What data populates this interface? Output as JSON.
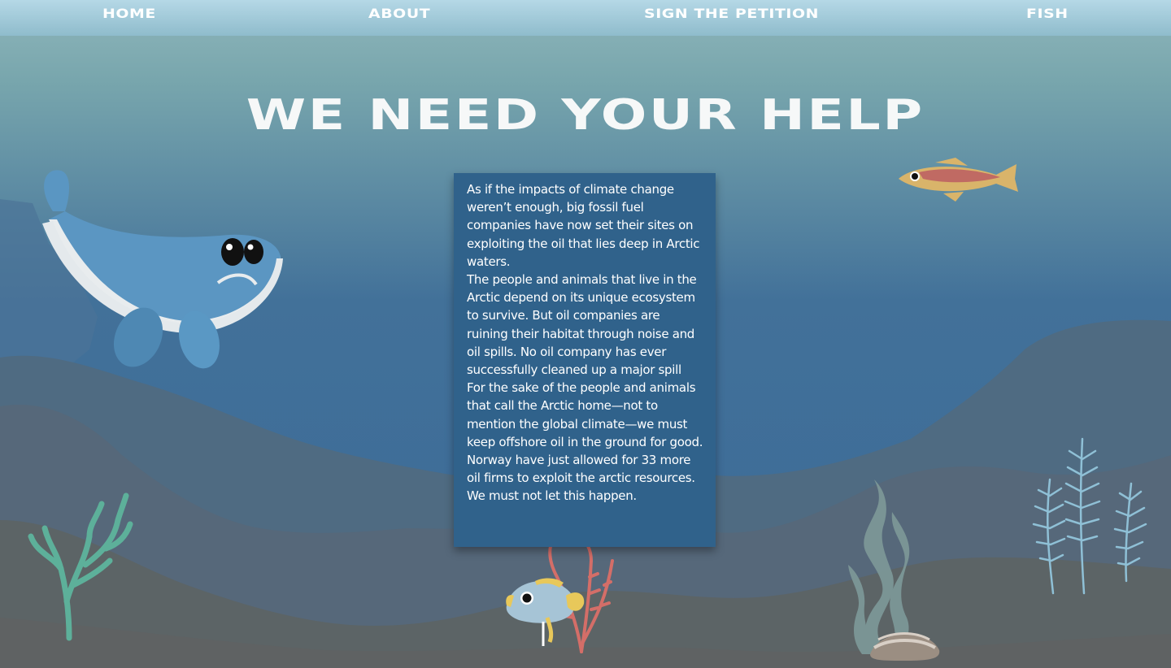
{
  "nav": {
    "items": [
      {
        "label": "HOME"
      },
      {
        "label": "ABOUT"
      },
      {
        "label": "SIGN THE PETITION"
      },
      {
        "label": "FISH"
      }
    ]
  },
  "hero": {
    "title": "WE NEED YOUR HELP"
  },
  "article": {
    "paragraphs": [
      "As if the impacts of climate change weren’t enough, big fossil fuel companies have now set their sites on exploiting the oil that lies deep in Arctic waters.",
      "The people and animals that live in the Arctic depend on its unique ecosystem to survive. But oil companies are ruining their habitat through noise and oil spills. No oil company has ever successfully cleaned up a major spill",
      "For the sake of the people and animals that call the Arctic home—not to mention the global climate—we must keep offshore oil in the ground for good. Norway have just allowed for 33 more oil firms to exploit the arctic resources. We must not let this happen."
    ]
  },
  "colors": {
    "sea_top": "#78a6ad",
    "sea_bottom": "#3d6b98",
    "seabed": "#5a6c7e",
    "textbox": "#30628b",
    "nav": "#a8d0dd"
  },
  "decorations": [
    "whale-icon",
    "salmon-icon",
    "yellow-fish-icon",
    "coral-icon",
    "kelp-icon",
    "fern-icon",
    "clam-icon"
  ]
}
